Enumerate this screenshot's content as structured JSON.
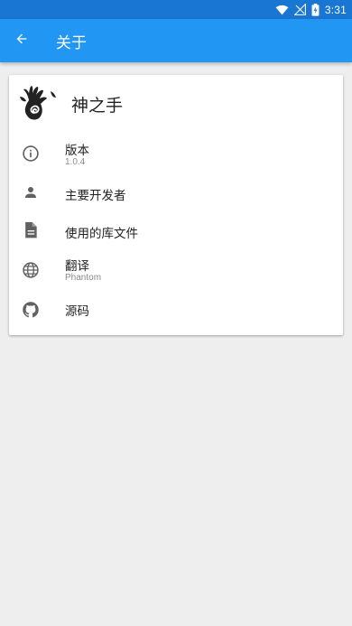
{
  "status_bar": {
    "time": "3:31",
    "icons": [
      "wifi-icon",
      "no-signal-icon",
      "battery-charging-icon"
    ]
  },
  "app_bar": {
    "back_icon": "arrow-back-icon",
    "title": "关于"
  },
  "card": {
    "app_name": "神之手",
    "logo_icon": "hand-spiral-logo",
    "items": [
      {
        "icon": "info-icon",
        "title": "版本",
        "subtitle": "1.0.4"
      },
      {
        "icon": "person-icon",
        "title": "主要开发者",
        "subtitle": ""
      },
      {
        "icon": "document-icon",
        "title": "使用的库文件",
        "subtitle": ""
      },
      {
        "icon": "globe-icon",
        "title": "翻译",
        "subtitle": "Phantom"
      },
      {
        "icon": "github-icon",
        "title": "源码",
        "subtitle": ""
      }
    ]
  },
  "colors": {
    "status_bar": "#1976d2",
    "app_bar": "#2196f3",
    "background": "#eeeeee",
    "card": "#ffffff",
    "icon_gray": "#757575"
  }
}
